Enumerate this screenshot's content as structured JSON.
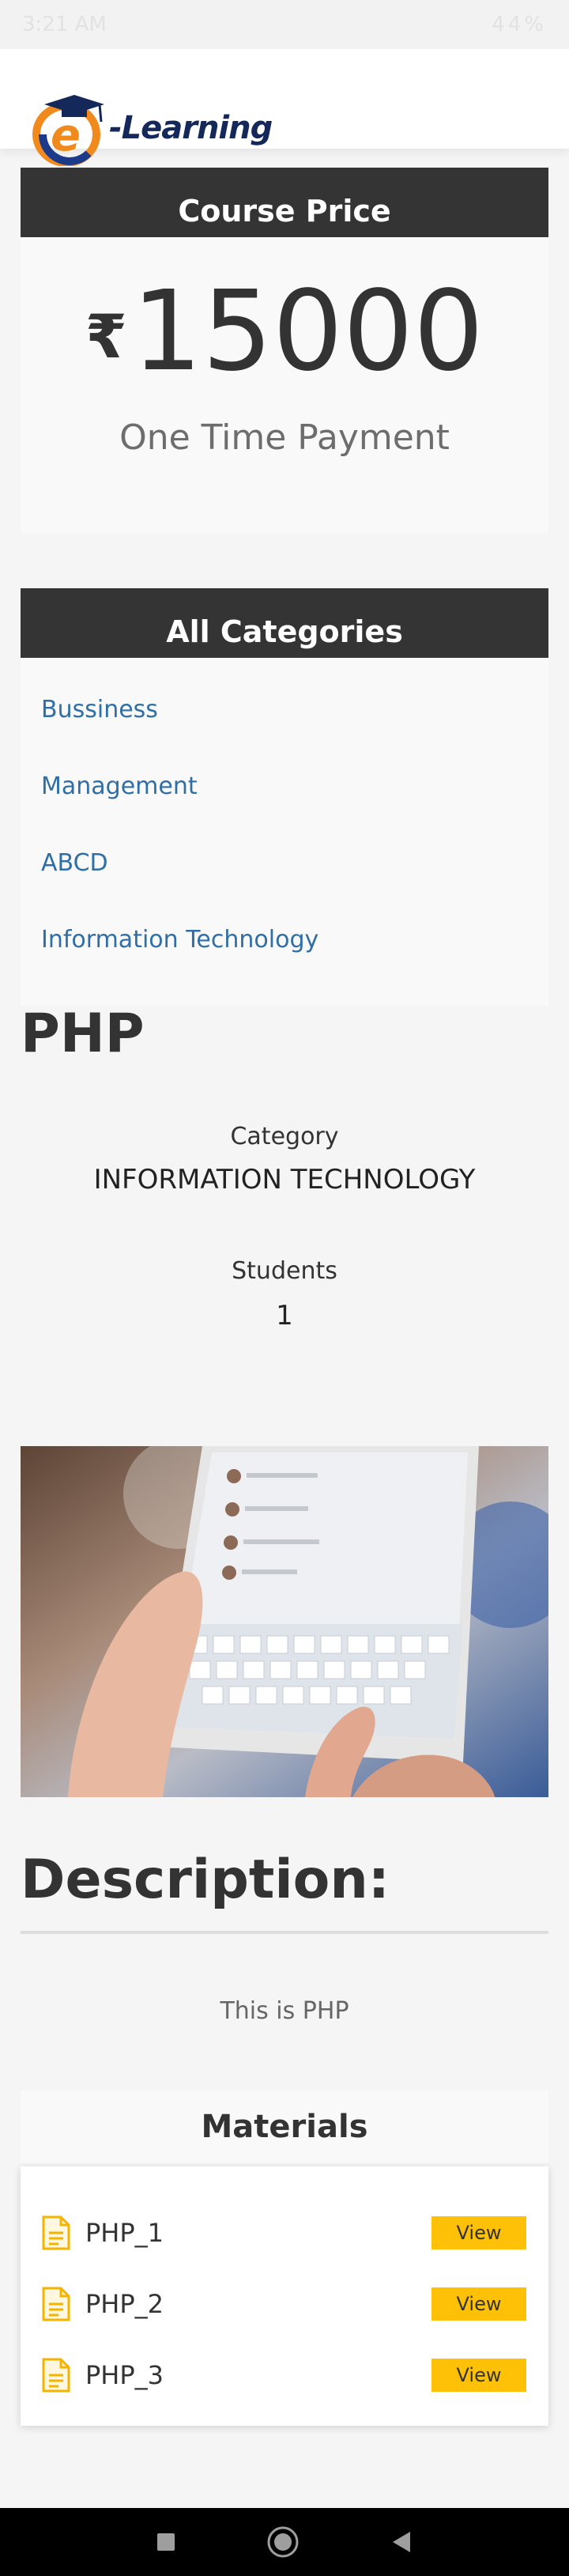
{
  "status_bar": {
    "time": "3:21 AM",
    "battery": "44%"
  },
  "header": {
    "logo_text": "-Learning"
  },
  "price_card": {
    "heading": "Course Price",
    "currency": "₹",
    "amount": "15000",
    "payment_type": "One Time Payment"
  },
  "categories": {
    "heading": "All Categories",
    "items": [
      "Bussiness",
      "Management",
      "ABCD",
      "Information Technology"
    ]
  },
  "course": {
    "title": "PHP",
    "category_label": "Category",
    "category_value": "INFORMATION TECHNOLOGY",
    "students_label": "Students",
    "students_value": "1"
  },
  "description": {
    "heading": "Description:",
    "text": "This is PHP"
  },
  "materials": {
    "heading": "Materials",
    "items": [
      {
        "name": "PHP_1",
        "action": "View"
      },
      {
        "name": "PHP_2",
        "action": "View"
      },
      {
        "name": "PHP_3",
        "action": "View"
      }
    ]
  },
  "colors": {
    "header_bar": "#343434",
    "link": "#2f6fa6",
    "view_button": "#ffc107",
    "file_icon": "#f5b400"
  }
}
